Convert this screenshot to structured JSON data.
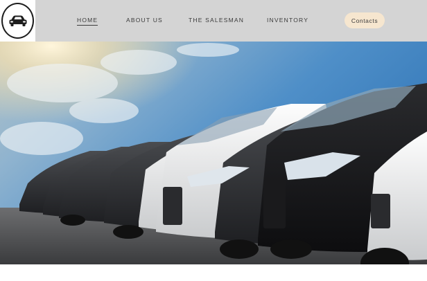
{
  "header": {
    "logo_icon": "car-icon",
    "background_color": "#d4d4d4"
  },
  "nav": {
    "items": [
      {
        "label": "HOME",
        "active": true
      },
      {
        "label": "ABOUT US",
        "active": false
      },
      {
        "label": "THE SALESMAN",
        "active": false
      },
      {
        "label": "INVENTORY",
        "active": false
      }
    ],
    "contacts_label": "Contacts",
    "contacts_color": "#f6e6cf"
  },
  "hero": {
    "image_subject": "row of parked cars under blue sky with sun",
    "sky_color": "#4f8fc8",
    "sun_color": "#fff6dc"
  }
}
